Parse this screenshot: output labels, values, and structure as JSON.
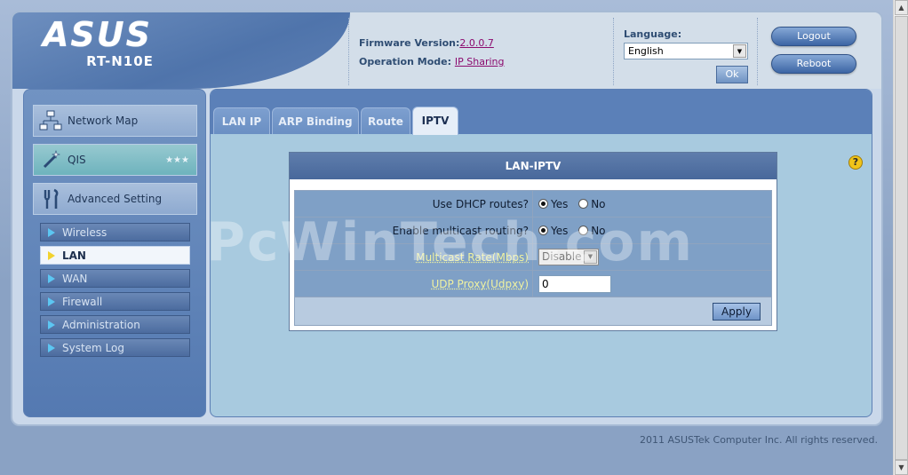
{
  "header": {
    "logo_text": "ASUS",
    "model": "RT-N10E",
    "firmware_label": "Firmware Version:",
    "firmware_value": "2.0.0.7",
    "mode_label": "Operation Mode:",
    "mode_value": "IP Sharing",
    "language_label": "Language:",
    "language_value": "English",
    "ok_label": "Ok",
    "logout_label": "Logout",
    "reboot_label": "Reboot"
  },
  "sidebar": {
    "main": [
      {
        "label": "Network Map",
        "icon": "network-map-icon"
      },
      {
        "label": "QIS",
        "icon": "magic-wand-icon"
      },
      {
        "label": "Advanced Setting",
        "icon": "wrench-icon"
      }
    ],
    "sub": [
      {
        "label": "Wireless",
        "active": false
      },
      {
        "label": "LAN",
        "active": true
      },
      {
        "label": "WAN",
        "active": false
      },
      {
        "label": "Firewall",
        "active": false
      },
      {
        "label": "Administration",
        "active": false
      },
      {
        "label": "System Log",
        "active": false
      }
    ]
  },
  "tabs": [
    {
      "label": "LAN IP",
      "active": false
    },
    {
      "label": "ARP Binding",
      "active": false
    },
    {
      "label": "Route",
      "active": false
    },
    {
      "label": "IPTV",
      "active": true
    }
  ],
  "panel": {
    "title": "LAN-IPTV",
    "dhcp_routes_label": "Use DHCP routes?",
    "multicast_routing_label": "Enable multicast routing?",
    "multicast_rate_label": "Multicast Rate(Mbps)",
    "multicast_rate_value": "Disable",
    "udp_proxy_label": "UDP Proxy(Udpxy)",
    "udp_proxy_value": "0",
    "yes_label": "Yes",
    "no_label": "No",
    "apply_label": "Apply"
  },
  "watermark": "PcWinTech.com",
  "footer": "2011 ASUSTek Computer Inc. All rights reserved.",
  "help_icon_glyph": "?"
}
